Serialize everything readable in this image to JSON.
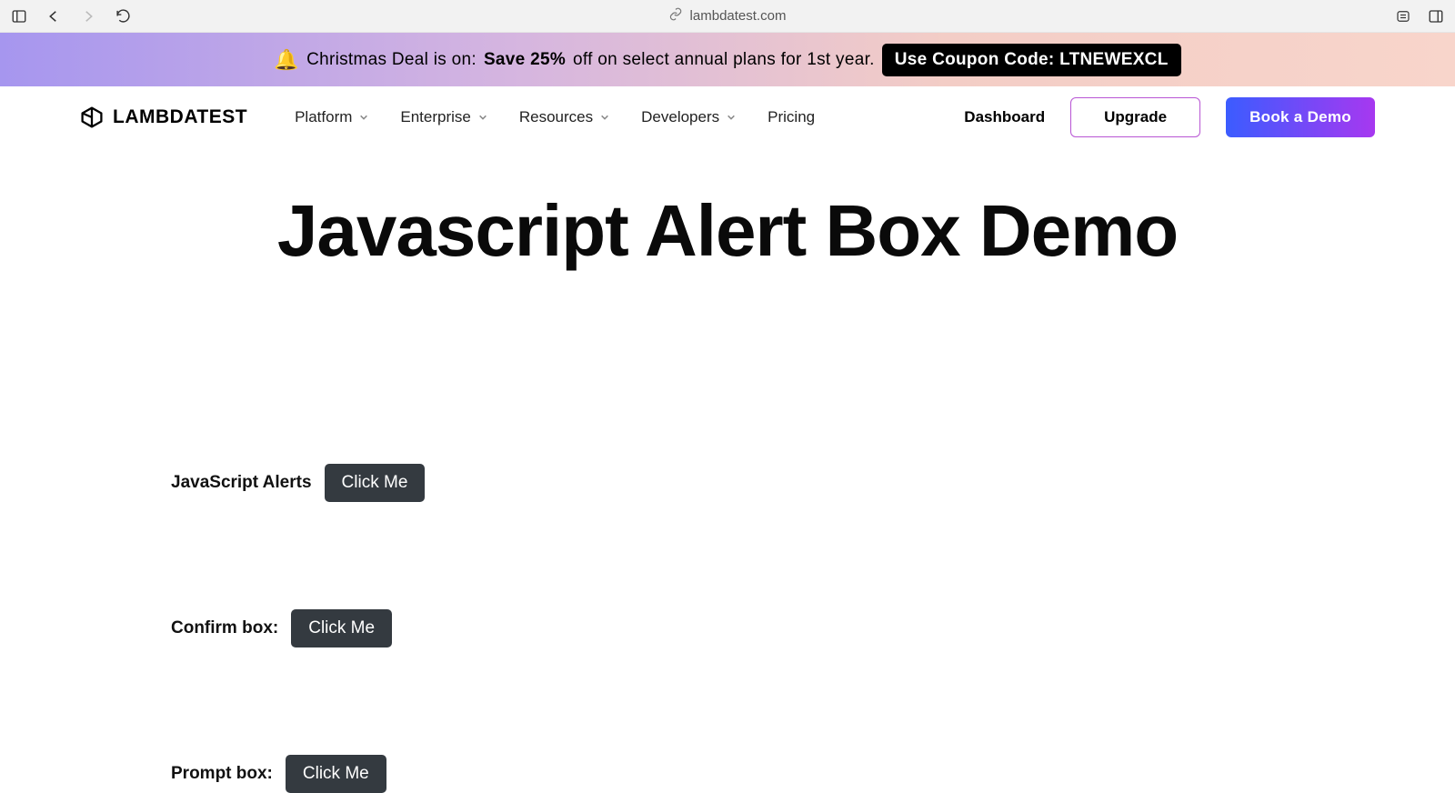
{
  "browser": {
    "url_domain": "lambdatest.com"
  },
  "promo": {
    "prefix": "Christmas Deal is on:",
    "bold": "Save 25%",
    "suffix": "off on select annual plans for 1st year.",
    "coupon_label": "Use Coupon Code: LTNEWEXCL"
  },
  "header": {
    "brand": "LAMBDATEST",
    "nav": {
      "platform": "Platform",
      "enterprise": "Enterprise",
      "resources": "Resources",
      "developers": "Developers",
      "pricing": "Pricing"
    },
    "dashboard": "Dashboard",
    "upgrade": "Upgrade",
    "demo": "Book a Demo"
  },
  "main": {
    "title": "Javascript Alert Box Demo",
    "rows": {
      "alerts": {
        "label": "JavaScript Alerts",
        "button": "Click Me"
      },
      "confirm": {
        "label": "Confirm box:",
        "button": "Click Me"
      },
      "prompt": {
        "label": "Prompt box:",
        "button": "Click Me"
      }
    }
  }
}
